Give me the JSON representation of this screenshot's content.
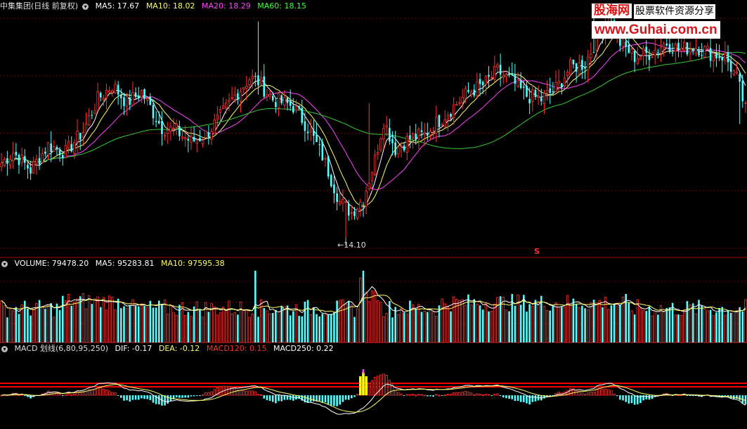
{
  "window": {
    "title": "中集集团(日线 前复权)"
  },
  "price_panel": {
    "indicators": [
      {
        "label": "MA5: 17.67",
        "color": "#ffffff"
      },
      {
        "label": "MA10: 18.02",
        "color": "#ffff66"
      },
      {
        "label": "MA20: 18.29",
        "color": "#ff44ff"
      },
      {
        "label": "MA60: 18.15",
        "color": "#44ff44"
      }
    ],
    "low_annotation": "←14.10",
    "marker": "S"
  },
  "volume_panel": {
    "indicators": [
      {
        "label": "VOLUME: 79478.20",
        "color": "#ffffff"
      },
      {
        "label": "MA5: 95283.81",
        "color": "#ffffff"
      },
      {
        "label": "MA10: 97595.38",
        "color": "#ffff66"
      }
    ]
  },
  "macd_panel": {
    "indicators": [
      {
        "label": "MACD 划线(6,80,95,250)",
        "color": "#dddddd"
      },
      {
        "label": "DIF: -0.17",
        "color": "#ffffff"
      },
      {
        "label": "DEA: -0.12",
        "color": "#ffff66"
      },
      {
        "label": "MACD120: 0.15",
        "color": "#ff3030"
      },
      {
        "label": "MACD250: 0.22",
        "color": "#ffffff"
      }
    ]
  },
  "logo": {
    "brand": "股海网",
    "tagline": "股票软件资源分享",
    "url": "www.Guhai.com.cn"
  },
  "colors": {
    "up": "#ff3333",
    "down": "#54ffff",
    "grid": "#7a0000",
    "ma60": "#33cc33",
    "macd_line": "#ff0000"
  },
  "chart_data": {
    "type": "candlestick",
    "price_range": [
      14.1,
      20.4
    ],
    "price_anchors": [
      [
        0,
        16.2
      ],
      [
        4,
        16.5
      ],
      [
        10,
        16.0
      ],
      [
        16,
        16.7
      ],
      [
        22,
        16.5
      ],
      [
        28,
        17.1
      ],
      [
        33,
        18.0
      ],
      [
        38,
        18.4
      ],
      [
        43,
        17.9
      ],
      [
        48,
        18.2
      ],
      [
        55,
        17.2
      ],
      [
        60,
        17.1
      ],
      [
        65,
        16.8
      ],
      [
        70,
        17.0
      ],
      [
        75,
        17.5
      ],
      [
        80,
        18.1
      ],
      [
        85,
        18.6
      ],
      [
        88,
        18.5
      ],
      [
        93,
        18.0
      ],
      [
        100,
        17.8
      ],
      [
        105,
        17.2
      ],
      [
        110,
        16.4
      ],
      [
        116,
        15.1
      ],
      [
        120,
        14.8
      ],
      [
        124,
        15.2
      ],
      [
        128,
        16.3
      ],
      [
        131,
        17.4
      ],
      [
        135,
        16.6
      ],
      [
        140,
        16.9
      ],
      [
        145,
        17.0
      ],
      [
        150,
        17.4
      ],
      [
        155,
        17.8
      ],
      [
        160,
        18.2
      ],
      [
        165,
        18.4
      ],
      [
        170,
        18.8
      ],
      [
        175,
        18.5
      ],
      [
        180,
        18.1
      ],
      [
        185,
        18.0
      ],
      [
        190,
        18.3
      ],
      [
        195,
        18.9
      ],
      [
        200,
        19.0
      ],
      [
        205,
        19.9
      ],
      [
        208,
        20.3
      ],
      [
        212,
        19.6
      ],
      [
        217,
        19.2
      ],
      [
        222,
        19.3
      ],
      [
        228,
        19.6
      ],
      [
        232,
        19.4
      ],
      [
        238,
        19.5
      ],
      [
        243,
        19.3
      ],
      [
        248,
        19.2
      ],
      [
        252,
        18.6
      ],
      [
        255,
        17.7
      ]
    ],
    "ma_values": {
      "MA5": 17.67,
      "MA10": 18.02,
      "MA20": 18.29,
      "MA60": 18.15
    },
    "low_label_value": 14.1,
    "volume_summary": {
      "VOLUME": 79478.2,
      "MA5": 95283.81,
      "MA10": 97595.38
    },
    "macd_summary": {
      "DIF": -0.17,
      "DEA": -0.12,
      "MACD120": 0.15,
      "MACD250": 0.22
    }
  }
}
